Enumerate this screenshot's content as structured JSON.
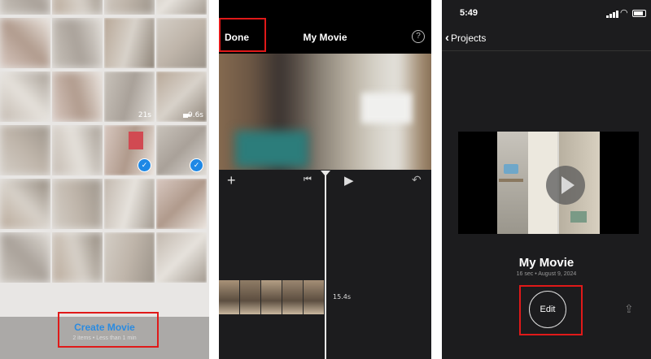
{
  "panel1": {
    "create_movie_label": "Create Movie",
    "create_movie_sub": "2 items • Less than 1 min",
    "clip_durations": [
      "21s",
      "9.6s"
    ],
    "check_glyph": "✓"
  },
  "panel2": {
    "done_label": "Done",
    "title": "My Movie",
    "help_glyph": "?",
    "add_glyph": "+",
    "rewind_glyph": "⏮",
    "play_glyph": "▶",
    "undo_glyph": "↶",
    "clip_duration": "15.4s"
  },
  "panel3": {
    "status_time": "5:49",
    "back_label": "Projects",
    "back_glyph": "‹",
    "wifi_glyph": "◠",
    "title": "My Movie",
    "subtitle": "16 sec • August 9, 2024",
    "edit_label": "Edit",
    "share_glyph": "⇪"
  },
  "colors": {
    "highlight_red": "#e01919",
    "accent_blue": "#2b8be0",
    "check_blue": "#1e88e5"
  }
}
